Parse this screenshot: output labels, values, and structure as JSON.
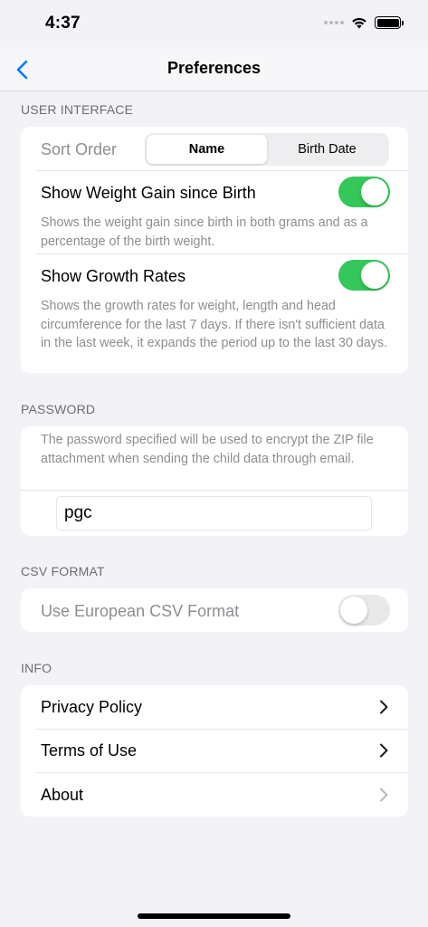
{
  "status_bar": {
    "time": "4:37"
  },
  "nav": {
    "title": "Preferences",
    "back_icon": "chevron-left-icon"
  },
  "user_interface": {
    "header": "USER INTERFACE",
    "sort_order": {
      "label": "Sort Order",
      "options": [
        "Name",
        "Birth Date"
      ],
      "selected": "Name"
    },
    "weight_gain": {
      "label": "Show Weight Gain since Birth",
      "enabled": true,
      "description": "Shows the weight gain since birth in both grams and as a percentage of the birth weight."
    },
    "growth_rates": {
      "label": "Show Growth Rates",
      "enabled": true,
      "description": "Shows the growth rates for weight, length and head circumference for the last 7 days. If there isn't sufficient data in the last week, it expands the period up to the last 30 days."
    }
  },
  "password": {
    "header": "PASSWORD",
    "description": "The password specified will be used to encrypt the ZIP file attachment when sending the child data through email.",
    "value": "pgc"
  },
  "csv_format": {
    "header": "CSV FORMAT",
    "european": {
      "label": "Use European CSV Format",
      "enabled": false
    }
  },
  "info": {
    "header": "INFO",
    "items": [
      {
        "label": "Privacy Policy"
      },
      {
        "label": "Terms of Use"
      },
      {
        "label": "About"
      }
    ]
  },
  "colors": {
    "accent": "#007aff",
    "toggle_on": "#34c759",
    "background": "#f2f2f7"
  }
}
